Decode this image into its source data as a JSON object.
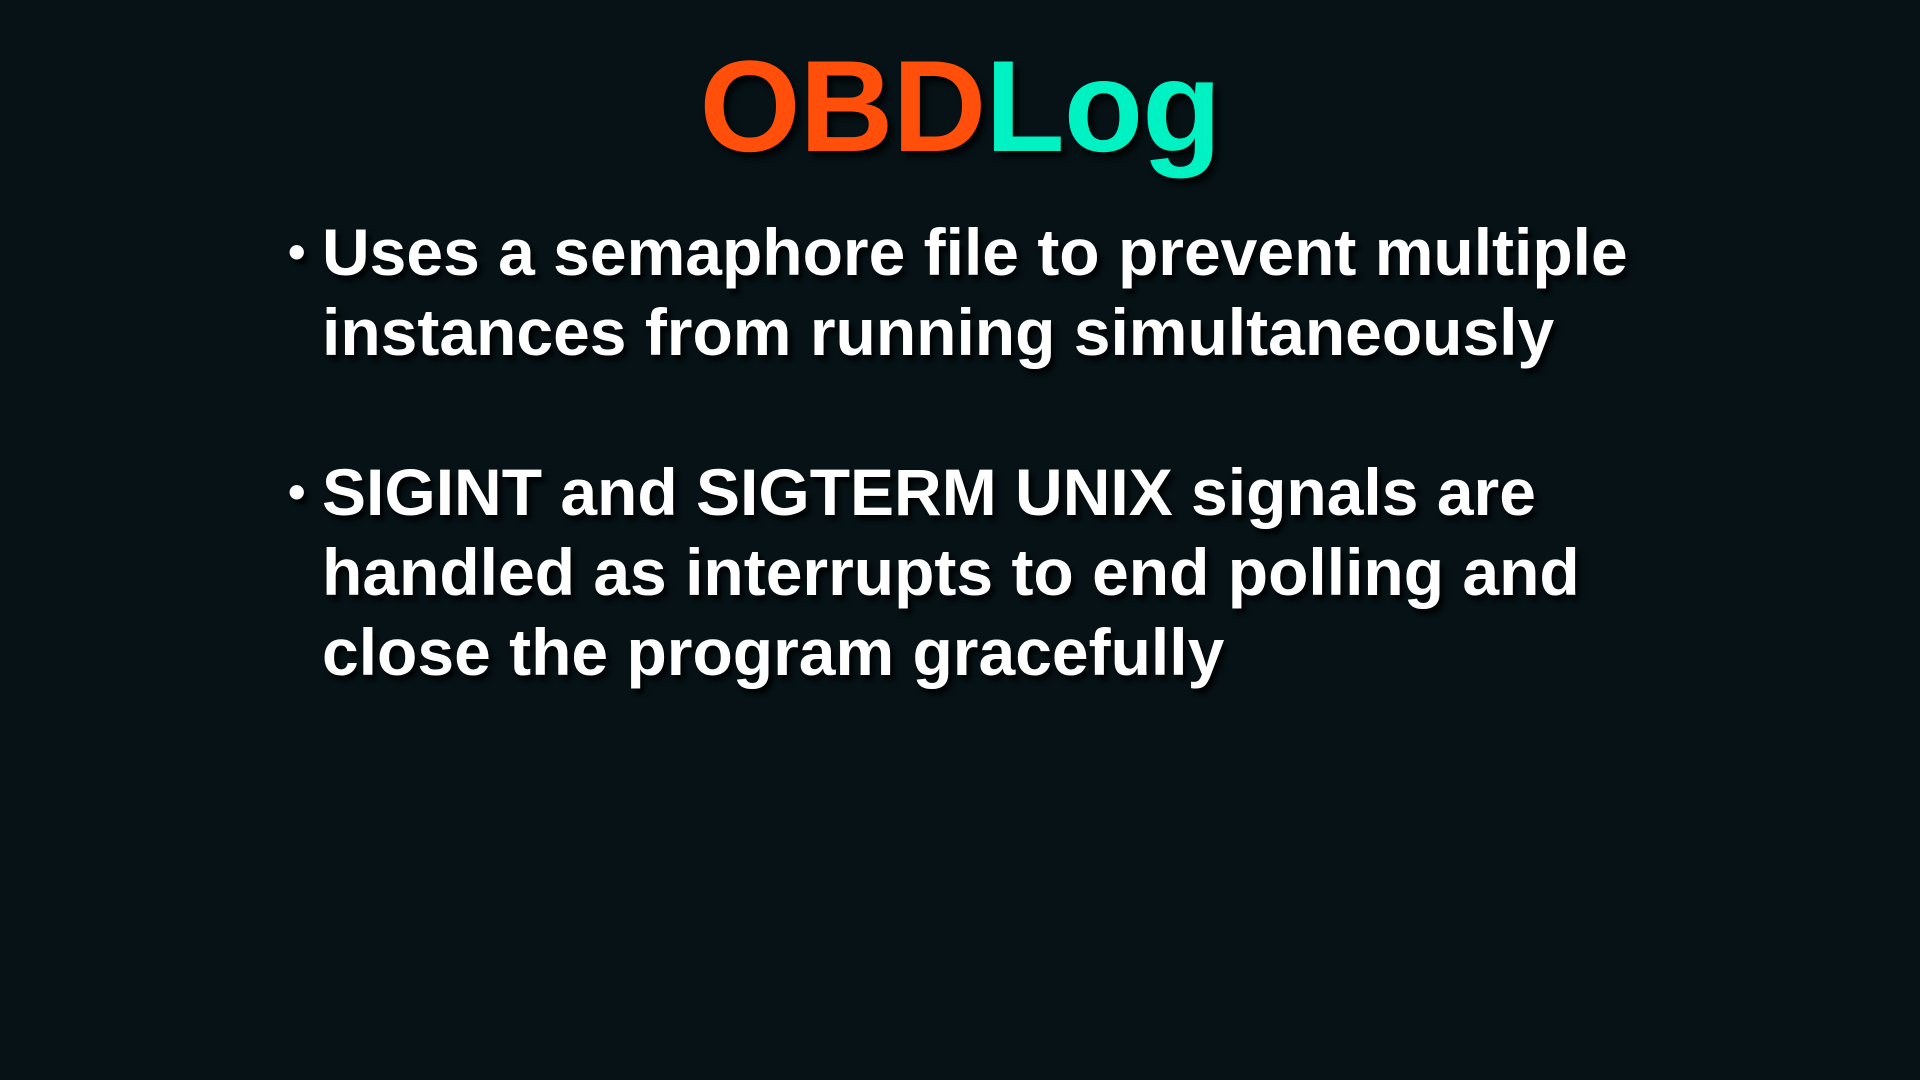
{
  "slide": {
    "title_part1": "OBD",
    "title_part2": "Log",
    "bullet_symbol": "•",
    "bullets": [
      {
        "text": "Uses a semaphore file to prevent multiple instances from running simultaneously"
      },
      {
        "text": "SIGINT and SIGTERM UNIX signals are handled as interrupts to end polling and close the program gracefully"
      }
    ]
  },
  "colors": {
    "background": "#061216",
    "title_part1": "#ff4f0a",
    "title_part2": "#00f2c3",
    "body_text": "#ffffff"
  }
}
